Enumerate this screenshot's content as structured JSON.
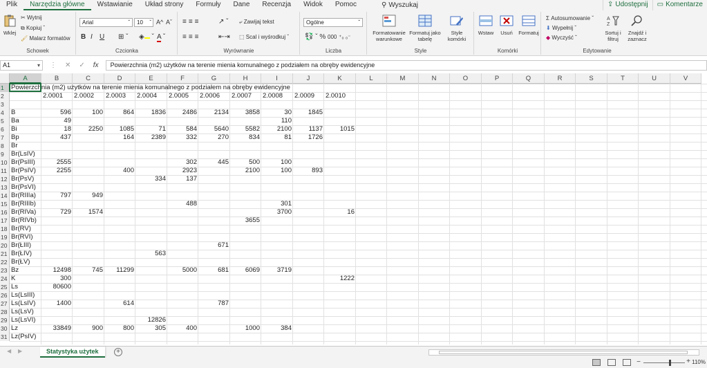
{
  "menu": {
    "tabs": [
      "Plik",
      "Narzędzia główne",
      "Wstawianie",
      "Układ strony",
      "Formuły",
      "Dane",
      "Recenzja",
      "Widok",
      "Pomoc"
    ],
    "active_index": 1,
    "search_label": "Wyszukaj",
    "share_label": "Udostępnij",
    "comments_label": "Komentarze"
  },
  "ribbon": {
    "clipboard": {
      "paste": "Wklej",
      "cut": "Wytnij",
      "copy": "Kopiuj",
      "format_painter": "Malarz formatów",
      "label": "Schowek"
    },
    "font": {
      "name": "Arial",
      "size": "10",
      "bold": "B",
      "italic": "I",
      "underline": "U",
      "grow": "A^",
      "shrink": "Aˇ",
      "label": "Czcionka"
    },
    "alignment": {
      "wrap": "Zawijaj tekst",
      "merge": "Scal i wyśrodkuj",
      "label": "Wyrównanie"
    },
    "number": {
      "format": "Ogólne",
      "label": "Liczba"
    },
    "styles": {
      "conditional": "Formatowanie warunkowe",
      "table": "Formatuj jako tabelę",
      "cell_styles": "Style komórki",
      "label": "Style"
    },
    "cells": {
      "insert": "Wstaw",
      "delete": "Usuń",
      "format": "Formatuj",
      "label": "Komórki"
    },
    "editing": {
      "autosum": "Autosumowanie",
      "fill": "Wypełnij",
      "clear": "Wyczyść",
      "sort": "Sortuj i filtruj",
      "find": "Znajdź i zaznacz",
      "label": "Edytowanie"
    }
  },
  "formula_bar": {
    "name_box": "A1",
    "formula": "Powierzchnia (m2) użytków na terenie mienia komunalnego z podziałem na obręby ewidencyjne"
  },
  "columns": [
    "A",
    "B",
    "C",
    "D",
    "E",
    "F",
    "G",
    "H",
    "I",
    "J",
    "K",
    "L",
    "M",
    "N",
    "O",
    "P",
    "Q",
    "R",
    "S",
    "T",
    "U",
    "V"
  ],
  "rows": [
    "1",
    "2",
    "3",
    "4",
    "5",
    "6",
    "7",
    "8",
    "9",
    "10",
    "11",
    "12",
    "13",
    "14",
    "15",
    "16",
    "17",
    "18",
    "19",
    "20",
    "21",
    "22",
    "23",
    "24",
    "25",
    "26",
    "27",
    "28",
    "29",
    "30",
    "31"
  ],
  "sheet_rows": [
    [
      "Powierzchnia (m2) użytków na terenie mienia komunalnego z podziałem na obręby ewidencyjne"
    ],
    [
      "",
      "2.0001",
      "2.0002",
      "2.0003",
      "2.0004",
      "2.0005",
      "2.0006",
      "2.0007",
      "2.0008",
      "2.0009",
      "2.0010"
    ],
    [
      ""
    ],
    [
      "B",
      "596",
      "100",
      "864",
      "1836",
      "2486",
      "2134",
      "3858",
      "30",
      "1845",
      ""
    ],
    [
      "Ba",
      "49",
      "",
      "",
      "",
      "",
      "",
      "",
      "110",
      "",
      ""
    ],
    [
      "Bi",
      "18",
      "2250",
      "1085",
      "71",
      "584",
      "5640",
      "5582",
      "2100",
      "1137",
      "1015"
    ],
    [
      "Bp",
      "437",
      "",
      "164",
      "2389",
      "332",
      "270",
      "834",
      "81",
      "1726",
      ""
    ],
    [
      "Br"
    ],
    [
      "Br(LsIV)"
    ],
    [
      "Br(PsIII)",
      "2555",
      "",
      "",
      "",
      "302",
      "445",
      "500",
      "100",
      "",
      ""
    ],
    [
      "Br(PsIV)",
      "2255",
      "",
      "400",
      "",
      "2923",
      "",
      "2100",
      "100",
      "893",
      ""
    ],
    [
      "Br(PsV)",
      "",
      "",
      "",
      "334",
      "137",
      "",
      "",
      "",
      "",
      ""
    ],
    [
      "Br(PsVI)"
    ],
    [
      "Br(RIIIa)",
      "797",
      "949",
      "",
      "",
      "",
      "",
      "",
      "",
      "",
      ""
    ],
    [
      "Br(RIIIb)",
      "",
      "",
      "",
      "",
      "488",
      "",
      "",
      "301",
      "",
      ""
    ],
    [
      "Br(RIVa)",
      "729",
      "1574",
      "",
      "",
      "",
      "",
      "",
      "3700",
      "",
      "16"
    ],
    [
      "Br(RIVb)",
      "",
      "",
      "",
      "",
      "",
      "",
      "3655",
      "",
      "",
      ""
    ],
    [
      "Br(RV)"
    ],
    [
      "Br(RVI)"
    ],
    [
      "Br(ŁIII)",
      "",
      "",
      "",
      "",
      "",
      "671",
      "",
      "",
      "",
      ""
    ],
    [
      "Br(ŁIV)",
      "",
      "",
      "",
      "563",
      "",
      "",
      "",
      "",
      "",
      ""
    ],
    [
      "Br(ŁV)"
    ],
    [
      "Bz",
      "12498",
      "745",
      "11299",
      "",
      "5000",
      "681",
      "6069",
      "3719",
      "",
      ""
    ],
    [
      "K",
      "300",
      "",
      "",
      "",
      "",
      "",
      "",
      "",
      "",
      "1222"
    ],
    [
      "Ls",
      "80600",
      "",
      "",
      "",
      "",
      "",
      "",
      "",
      "",
      ""
    ],
    [
      "Ls(LsIII)"
    ],
    [
      "Ls(LsIV)",
      "1400",
      "",
      "614",
      "",
      "",
      "787",
      "",
      "",
      "",
      ""
    ],
    [
      "Ls(LsV)"
    ],
    [
      "Ls(LsVI)",
      "",
      "",
      "",
      "12826",
      "",
      "",
      "",
      "",
      "",
      ""
    ],
    [
      "Lz",
      "33849",
      "900",
      "800",
      "305",
      "400",
      "",
      "1000",
      "384",
      "",
      ""
    ],
    [
      "Lz(PsIV)"
    ]
  ],
  "sheet_tab": "Statystyka użytek",
  "zoom": "110%",
  "colors": {
    "accent": "#1e6e3e"
  }
}
